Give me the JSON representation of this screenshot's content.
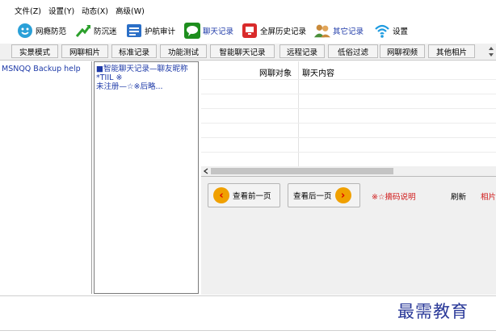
{
  "menu": {
    "file": "文件(Z)",
    "settings": "设置(Y)",
    "dynamic": "动态(X)",
    "advanced": "高级(W)"
  },
  "toolbar": {
    "items": [
      {
        "label": "网瘾防范",
        "icon": "face-icon",
        "color": "#2aa0d8"
      },
      {
        "label": "防沉迷",
        "icon": "arrow-icon",
        "color": "#2ca02c"
      },
      {
        "label": "护航审计",
        "icon": "list-icon",
        "color": "#2b6fc7"
      },
      {
        "label": "聊天记录",
        "icon": "chat-bubble-icon",
        "color": "#1e8e1e"
      },
      {
        "label": "全屏历史记录",
        "icon": "screen-history-icon",
        "color": "#d92b2b"
      },
      {
        "label": "其它记录",
        "icon": "people-icon",
        "color": "#c98a3a"
      },
      {
        "label": "设置",
        "icon": "wifi-icon",
        "color": "#1e9be0"
      }
    ]
  },
  "tabs": [
    "实景模式",
    "网聊相片",
    "标准记录",
    "功能测试",
    "智能聊天记录",
    "远程记录",
    "低俗过滤",
    "网聊视频",
    "其他相片"
  ],
  "left_pane": {
    "item": "MSNQQ Backup help"
  },
  "mid_pane": {
    "line1": "■智能聊天记录—聊友昵称",
    "line2": "*TIIL ※",
    "line3": "未注册—☆※后略..."
  },
  "chat_table": {
    "col_peer": "网聊对象",
    "col_content": "聊天内容"
  },
  "controls": {
    "prev_page": "查看前一页",
    "next_page": "查看后一页",
    "code_note": "※☆摘码说明",
    "refresh": "刷新",
    "photo": "相片"
  },
  "watermark": "最需教育"
}
